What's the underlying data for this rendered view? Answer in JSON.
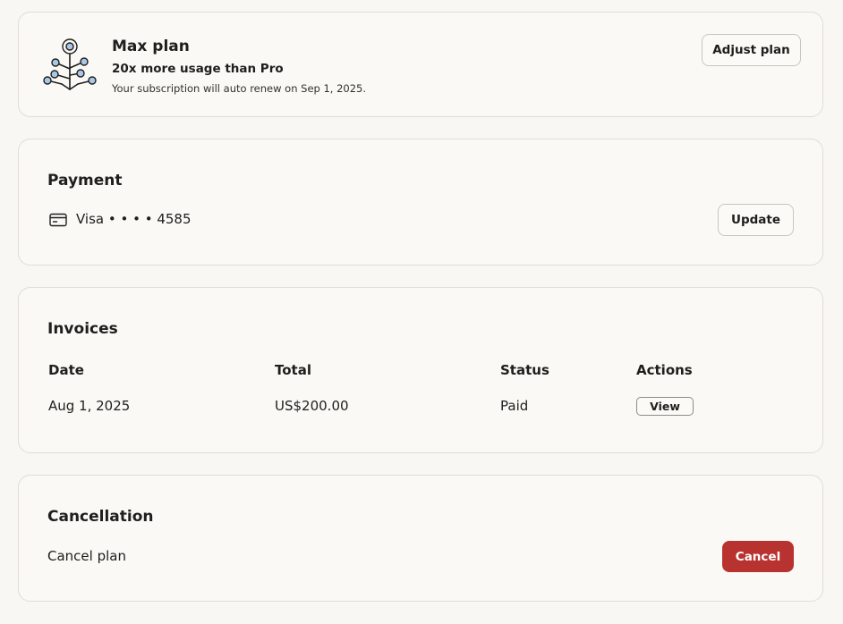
{
  "plan": {
    "name": "Max plan",
    "tagline": "20x more usage than Pro",
    "renew_text": "Your subscription will auto renew on Sep 1, 2025.",
    "adjust_label": "Adjust plan",
    "icon": "plant-tree-icon"
  },
  "payment": {
    "title": "Payment",
    "card_text": "Visa • • • • 4585",
    "icon": "credit-card-icon",
    "update_label": "Update"
  },
  "invoices": {
    "title": "Invoices",
    "headers": [
      "Date",
      "Total",
      "Status",
      "Actions"
    ],
    "rows": [
      {
        "date": "Aug 1, 2025",
        "total": "US$200.00",
        "status": "Paid",
        "action_label": "View"
      }
    ]
  },
  "cancellation": {
    "title": "Cancellation",
    "label": "Cancel plan",
    "button_label": "Cancel"
  },
  "colors": {
    "background": "#f8f7f3",
    "cancel_button": "#b8322f",
    "icon_fill": "#a9c8e6"
  }
}
